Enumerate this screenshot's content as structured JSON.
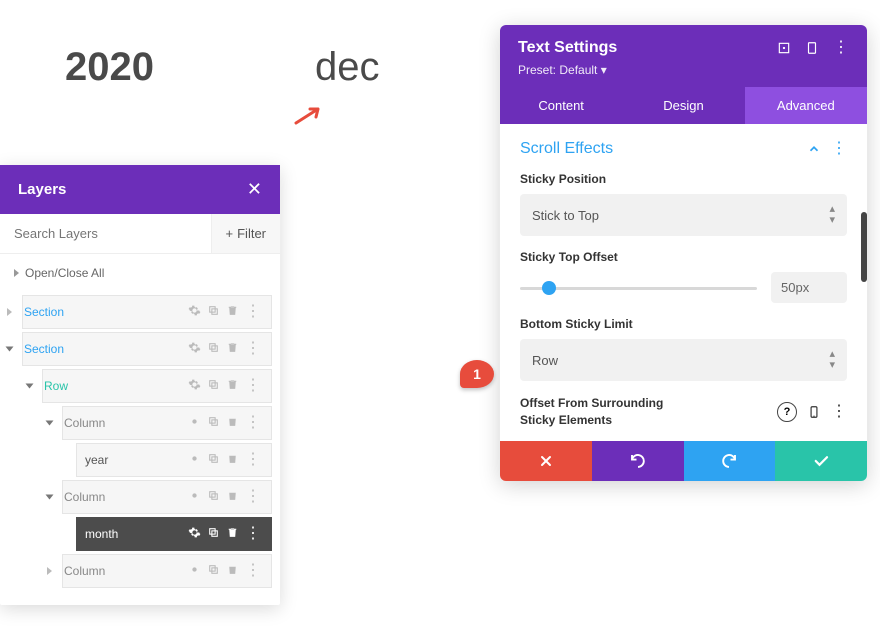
{
  "preview": {
    "year": "2020",
    "month": "dec"
  },
  "layers": {
    "title": "Layers",
    "search_placeholder": "Search Layers",
    "filter_label": "Filter",
    "open_close": "Open/Close All",
    "items": {
      "section1": "Section",
      "section2": "Section",
      "row": "Row",
      "col1": "Column",
      "mod_year": "year",
      "col2": "Column",
      "mod_month": "month",
      "col3": "Column"
    }
  },
  "settings": {
    "title": "Text Settings",
    "preset": "Preset: Default",
    "tabs": {
      "content": "Content",
      "design": "Design",
      "advanced": "Advanced"
    },
    "section": "Scroll Effects",
    "fields": {
      "sticky_position": {
        "label": "Sticky Position",
        "value": "Stick to Top"
      },
      "sticky_top_offset": {
        "label": "Sticky Top Offset",
        "value": "50px"
      },
      "bottom_limit": {
        "label": "Bottom Sticky Limit",
        "value": "Row"
      },
      "offset_surround": {
        "label": "Offset From Surrounding Sticky Elements"
      }
    }
  },
  "callout": "1",
  "icons": {
    "help": "?",
    "caret": "⌃⌄"
  }
}
